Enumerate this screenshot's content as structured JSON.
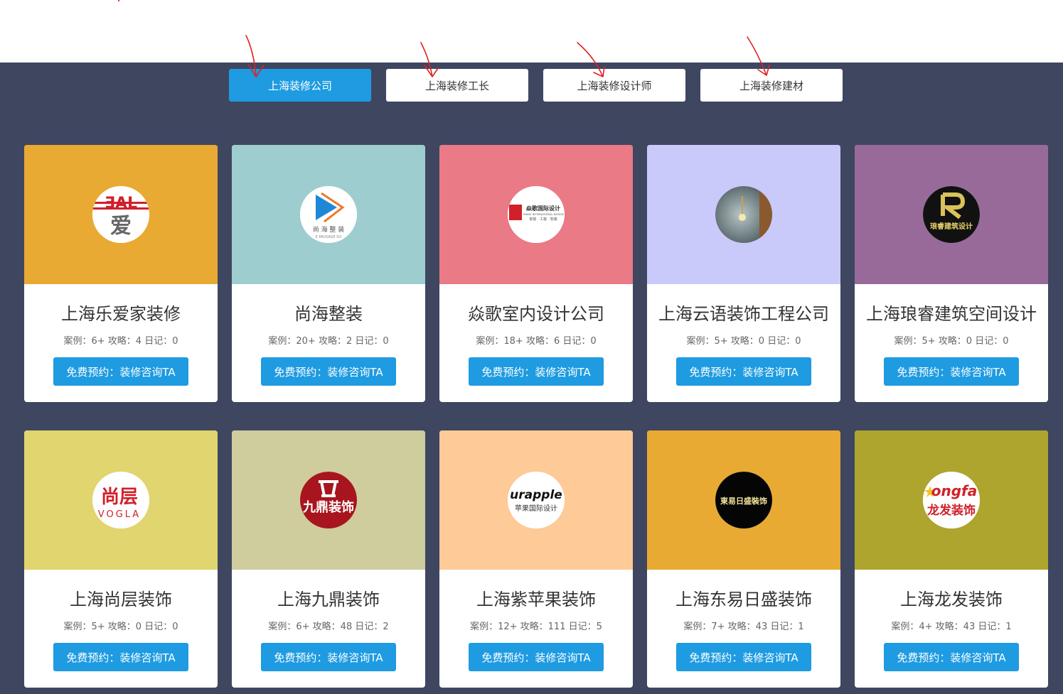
{
  "tabs": [
    {
      "label": "上海装修公司",
      "active": true
    },
    {
      "label": "上海装修工长",
      "active": false
    },
    {
      "label": "上海装修设计师",
      "active": false
    },
    {
      "label": "上海装修建材",
      "active": false
    }
  ],
  "colors": {
    "accent": "#1e9be1",
    "background": "#3f4660",
    "annotation": "#e02020"
  },
  "companies": [
    {
      "name": "上海乐爱家装修",
      "stats": "案例：6+ 攻略：4 日记：0",
      "button": "免费预约：装修咨询TA",
      "color": "#e8aa33",
      "logo_text": [
        "ƎAL",
        "爱"
      ]
    },
    {
      "name": "尚海整装",
      "stats": "案例：20+ 攻略：2 日记：0",
      "button": "免费预约：装修咨询TA",
      "color": "#9ecdd0",
      "logo_text": [
        "尚 海 整 装",
        "E PACKAGE SO"
      ]
    },
    {
      "name": "焱歌室内设计公司",
      "stats": "案例：18+ 攻略：6 日记：0",
      "button": "免费预约：装修咨询TA",
      "color": "#e97a86",
      "logo_text": [
        "焱歌国际设计",
        "YANGE INTERNATIONAL DESIGN",
        "家装 · 工装 · 软装"
      ]
    },
    {
      "name": "上海云语装饰工程公司",
      "stats": "案例：5+ 攻略：0 日记：0",
      "button": "免费预约：装修咨询TA",
      "color": "#c9cafa",
      "logo_text": []
    },
    {
      "name": "上海琅睿建筑空间设计",
      "stats": "案例：5+ 攻略：0 日记：0",
      "button": "免费预约：装修咨询TA",
      "color": "#986a9a",
      "logo_text": [
        "琅睿建筑设计"
      ]
    },
    {
      "name": "上海尚层装饰",
      "stats": "案例：5+ 攻略：0 日记：0",
      "button": "免费预约：装修咨询TA",
      "color": "#e0d56e",
      "logo_text": [
        "尚层",
        "VOGLA"
      ]
    },
    {
      "name": "上海九鼎装饰",
      "stats": "案例：6+ 攻略：48 日记：2",
      "button": "免费预约：装修咨询TA",
      "color": "#cfcc9d",
      "logo_text": [
        "九鼎装饰"
      ]
    },
    {
      "name": "上海紫苹果装饰",
      "stats": "案例：12+ 攻略：111 日记：5",
      "button": "免费预约：装修咨询TA",
      "color": "#fdca98",
      "logo_text": [
        "urapple",
        "苹果国际设计"
      ]
    },
    {
      "name": "上海东易日盛装饰",
      "stats": "案例：7+ 攻略：43 日记：1",
      "button": "免费预约：装修咨询TA",
      "color": "#e8aa33",
      "logo_text": [
        "東易日盛裝饰"
      ]
    },
    {
      "name": "上海龙发装饰",
      "stats": "案例：4+ 攻略：43 日记：1",
      "button": "免费预约：装修咨询TA",
      "color": "#ada52e",
      "logo_text": [
        "ongfa",
        "龙发装饰"
      ]
    }
  ]
}
